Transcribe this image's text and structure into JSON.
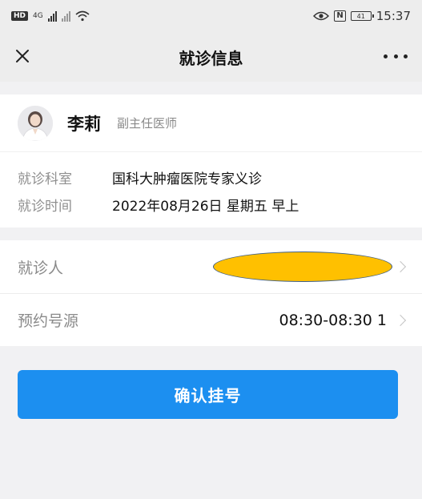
{
  "status_bar": {
    "badge": "HD",
    "network": "4G",
    "time": "15:37",
    "battery": "41"
  },
  "nav": {
    "title": "就诊信息",
    "close_icon": "close-icon",
    "more_icon": "more-icon"
  },
  "doctor": {
    "name": "李莉",
    "title": "副主任医师"
  },
  "visit_info": {
    "dept_label": "就诊科室",
    "dept_value": "国科大肿瘤医院专家义诊",
    "time_label": "就诊时间",
    "time_value": "2022年08月26日 星期五 早上"
  },
  "patient_row": {
    "label": "就诊人",
    "value": ""
  },
  "slot_row": {
    "label": "预约号源",
    "value": "08:30-08:30 1"
  },
  "confirm_button": {
    "label": "确认挂号"
  },
  "colors": {
    "accent": "#1c8ff0",
    "redaction": "#ffc000"
  }
}
